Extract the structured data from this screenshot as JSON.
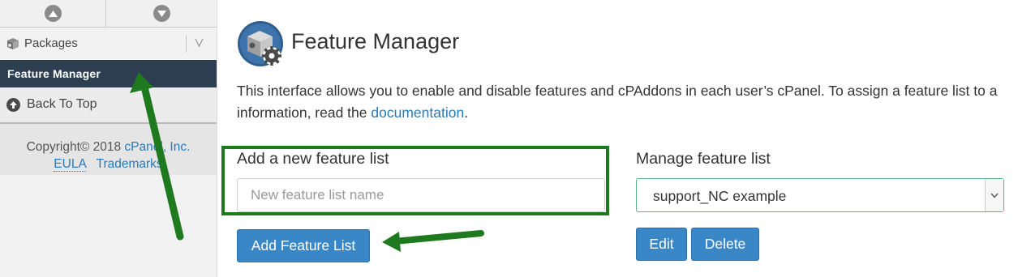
{
  "sidebar": {
    "scroll_up_icon": "circle-chevron-up-icon",
    "scroll_down_icon": "circle-chevron-down-icon",
    "packages": {
      "label": "Packages",
      "icon": "package-icon",
      "collapse_icon": "chevron-down-icon"
    },
    "active_item": {
      "label": "Feature Manager"
    },
    "back_to_top": {
      "label": "Back To Top",
      "icon": "arrow-up-circle-icon"
    },
    "footer": {
      "copyright": "Copyright© 2018",
      "company": "cPanel, Inc.",
      "eula": "EULA",
      "trademarks": "Trademarks"
    }
  },
  "main": {
    "title": "Feature Manager",
    "title_icon": "feature-manager-gear-icon",
    "description_line1": "This interface allows you to enable and disable features and cPAddons in each user’s cPanel. To assign a feature list to a",
    "description_line2_prefix": "information, read the",
    "documentation_link": "documentation",
    "description_line2_suffix": ".",
    "add_section": {
      "label": "Add a new feature list",
      "input_value": "",
      "input_placeholder": "New feature list name",
      "button": "Add Feature List"
    },
    "manage_section": {
      "label": "Manage feature list",
      "selected_value": "support_NC example",
      "edit_button": "Edit",
      "delete_button": "Delete"
    }
  },
  "colors": {
    "sidebar_active_bg": "#2d3e50",
    "primary_button": "#3a87c7",
    "link": "#2a7ab8",
    "annotation_green": "#1f7a1f"
  }
}
